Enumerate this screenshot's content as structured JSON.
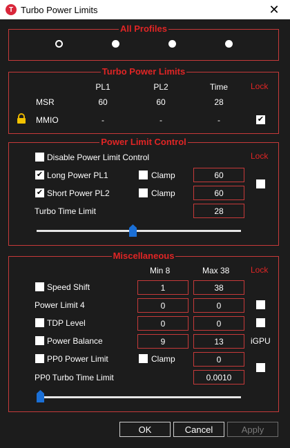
{
  "window": {
    "title": "Turbo Power Limits",
    "app_icon": "T"
  },
  "profiles": {
    "title": "All Profiles",
    "count": 4,
    "selected": 0
  },
  "tpl": {
    "title": "Turbo Power Limits",
    "col_pl1": "PL1",
    "col_pl2": "PL2",
    "col_time": "Time",
    "lock": "Lock",
    "msr": {
      "label": "MSR",
      "pl1": "60",
      "pl2": "60",
      "time": "28"
    },
    "mmio": {
      "label": "MMIO",
      "pl1": "-",
      "pl2": "-",
      "time": "-",
      "lock_checked": true
    }
  },
  "plc": {
    "title": "Power Limit Control",
    "lock": "Lock",
    "disable_label": "Disable Power Limit Control",
    "disable_checked": false,
    "long_label": "Long Power PL1",
    "long_checked": true,
    "long_clamp_label": "Clamp",
    "long_clamp_checked": false,
    "long_value": "60",
    "short_label": "Short Power PL2",
    "short_checked": true,
    "short_clamp_label": "Clamp",
    "short_clamp_checked": false,
    "short_value": "60",
    "lock_checked": false,
    "turbo_time_label": "Turbo Time Limit",
    "turbo_time_value": "28",
    "slider_level": 0.47
  },
  "misc": {
    "title": "Miscellaneous",
    "min_label": "Min  8",
    "max_label": "Max  38",
    "lock": "Lock",
    "speed_shift": {
      "label": "Speed Shift",
      "checked": false,
      "min": "1",
      "max": "38"
    },
    "power_limit_4": {
      "label": "Power Limit 4",
      "min": "0",
      "max": "0",
      "lock_checked": false
    },
    "tdp_level": {
      "label": "TDP Level",
      "checked": false,
      "min": "0",
      "max": "0",
      "lock_checked": false
    },
    "power_balance": {
      "label": "Power Balance",
      "checked": false,
      "min": "9",
      "max": "13",
      "extra": "iGPU"
    },
    "pp0_power_limit": {
      "label": "PP0 Power Limit",
      "checked": false,
      "clamp_label": "Clamp",
      "clamp_checked": false,
      "value": "0",
      "lock_checked": false
    },
    "pp0_turbo_time": {
      "label": "PP0 Turbo Time Limit",
      "value": "0.0010"
    },
    "slider_level": 0.0
  },
  "buttons": {
    "ok": "OK",
    "cancel": "Cancel",
    "apply": "Apply"
  },
  "colors": {
    "accent_red": "#e02525",
    "border_red": "#c83a3a",
    "slider_thumb": "#1a6fd6",
    "background": "#1c1c1c"
  }
}
